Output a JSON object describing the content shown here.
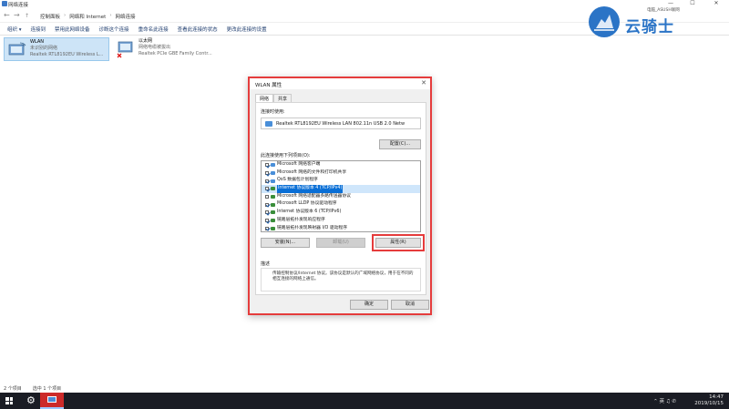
{
  "window": {
    "title": "网络连接",
    "controls": [
      "—",
      "☐",
      "✕"
    ]
  },
  "address": {
    "crumbs": [
      "控制面板",
      "网络和 Internet",
      "网络连接"
    ]
  },
  "toolbar": {
    "items": [
      "组织 ▾",
      "连接到",
      "禁用此网络设备",
      "诊断这个连接",
      "重命名此连接",
      "查看此连接的状态",
      "更改此连接的设置"
    ]
  },
  "connections": [
    {
      "name": "WLAN",
      "status": "未识别的网络",
      "device": "Realtek RTL8192EU Wireless L..."
    },
    {
      "name": "以太网",
      "status": "网络电缆被拔出",
      "device": "Realtek PCIe GBE Family Contr..."
    }
  ],
  "statusbar": {
    "count": "2 个项目",
    "selected": "选中 1 个项目"
  },
  "watermark": {
    "text": "云骑士",
    "small": "电脑_ASUSH联网"
  },
  "taskbar": {
    "tray_icons": "⌃  英 ♫  ✆",
    "time": "14:47",
    "date": "2019/10/15"
  },
  "dialog": {
    "title": "WLAN 属性",
    "tabs": [
      "网络",
      "共享"
    ],
    "connect_using_label": "连接时使用:",
    "adapter": "Realtek RTL8192EU Wireless LAN 802.11n USB 2.0 Netw",
    "configure_button": "配置(C)...",
    "items_label": "此连接使用下列项目(O):",
    "items": [
      {
        "label": "Microsoft 网络客户端",
        "checked": true,
        "selected": false
      },
      {
        "label": "Microsoft 网络的文件和打印机共享",
        "checked": true,
        "selected": false
      },
      {
        "label": "QoS 数据包计划程序",
        "checked": true,
        "selected": false
      },
      {
        "label": "Internet 协议版本 4 (TCP/IPv4)",
        "checked": true,
        "selected": true
      },
      {
        "label": "Microsoft 网络适配器多路传送器协议",
        "checked": false,
        "selected": false
      },
      {
        "label": "Microsoft LLDP 协议驱动程序",
        "checked": true,
        "selected": false
      },
      {
        "label": "Internet 协议版本 6 (TCP/IPv6)",
        "checked": true,
        "selected": false
      },
      {
        "label": "链路层拓扑发现响应程序",
        "checked": true,
        "selected": false
      },
      {
        "label": "链路层拓扑发现映射器 I/O 驱动程序",
        "checked": true,
        "selected": false
      }
    ],
    "install_button": "安装(N)...",
    "uninstall_button": "卸载(U)",
    "properties_button": "属性(R)",
    "description_label": "描述",
    "description": "传输控制协议/Internet 协议。该协议是默认的广域网络协议，用于在不同的相互连接的网络上通信。",
    "ok_button": "确定",
    "cancel_button": "取消"
  }
}
